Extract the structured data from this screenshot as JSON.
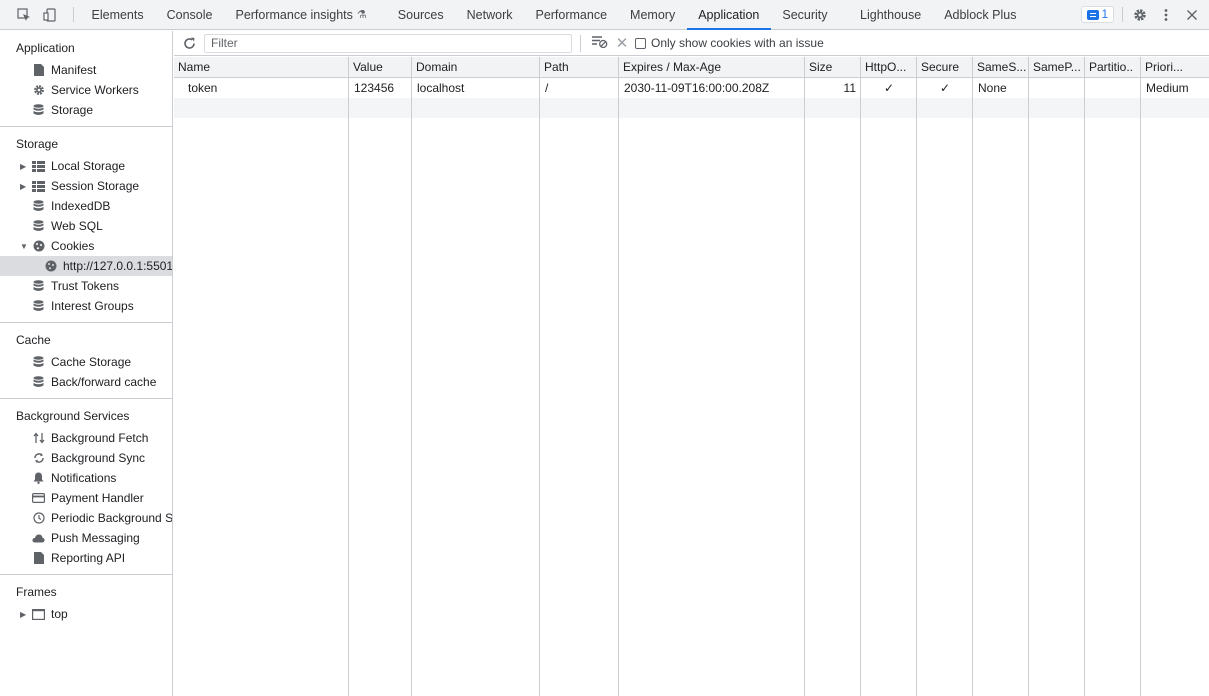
{
  "topbar": {
    "tabs": [
      "Elements",
      "Console",
      "Performance insights",
      "Sources",
      "Network",
      "Performance",
      "Memory",
      "Application",
      "Security",
      "Lighthouse",
      "Adblock Plus"
    ],
    "active_tab": "Application",
    "issues_count": "1",
    "icons": [
      "inspect-element-icon",
      "device-toolbar-icon",
      "flask-icon",
      "issues-icon",
      "gear-icon",
      "more-options-icon",
      "close-icon"
    ]
  },
  "sidebar": {
    "application": {
      "title": "Application",
      "items": [
        "Manifest",
        "Service Workers",
        "Storage"
      ]
    },
    "storage": {
      "title": "Storage",
      "items": [
        "Local Storage",
        "Session Storage",
        "IndexedDB",
        "Web SQL",
        "Cookies"
      ],
      "cookie_origin": "http://127.0.0.1:5501",
      "extra_items": [
        "Trust Tokens",
        "Interest Groups"
      ]
    },
    "cache": {
      "title": "Cache",
      "items": [
        "Cache Storage",
        "Back/forward cache"
      ]
    },
    "background": {
      "title": "Background Services",
      "items": [
        "Background Fetch",
        "Background Sync",
        "Notifications",
        "Payment Handler",
        "Periodic Background Sync",
        "Push Messaging",
        "Reporting API"
      ]
    },
    "frames": {
      "title": "Frames",
      "items": [
        "top"
      ]
    }
  },
  "toolbar": {
    "filter_placeholder": "Filter",
    "only_issues_label": "Only show cookies with an issue"
  },
  "table": {
    "columns": [
      "Name",
      "Value",
      "Domain",
      "Path",
      "Expires / Max-Age",
      "Size",
      "HttpO...",
      "Secure",
      "SameS...",
      "SameP...",
      "Partitio..",
      "Priori..."
    ],
    "rows": [
      [
        "token",
        "123456",
        "localhost",
        "/",
        "2030-11-09T16:00:00.208Z",
        "11",
        "✓",
        "✓",
        "None",
        "",
        "",
        "Medium"
      ]
    ]
  },
  "colors": {
    "accent": "#1a73e8",
    "border": "#cacdd1",
    "toolbar_bg": "#f1f3f4"
  }
}
